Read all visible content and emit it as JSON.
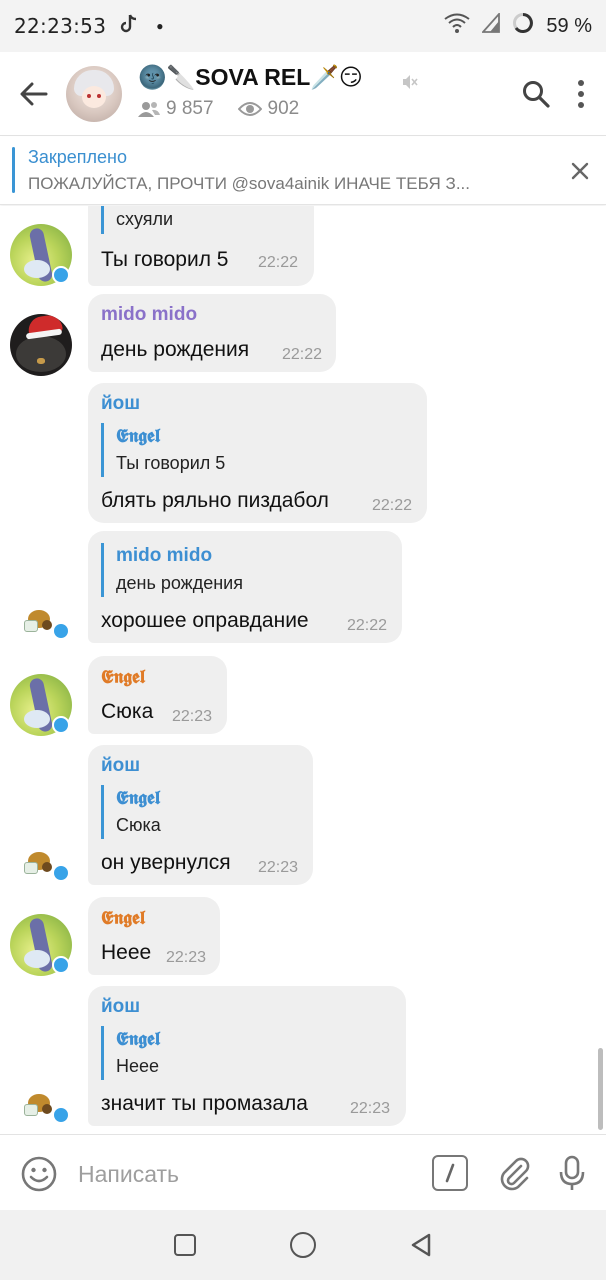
{
  "status_bar": {
    "time": "22:23:53",
    "battery": "59 %",
    "icons": [
      "tiktok-icon",
      "dot-icon",
      "wifi-icon",
      "signal-icon",
      "battery-ring-icon"
    ]
  },
  "header": {
    "title_prefix_emoji": "🌚🔪",
    "title_text": "SOVA REL",
    "title_suffix_emoji": "🗡️😏",
    "subscribers": "9 857",
    "viewers": "902"
  },
  "pinned": {
    "label": "Закреплено",
    "text": "ПОЖАЛУЙСТА, ПРОЧТИ @sova4ainik ИНАЧЕ ТЕБЯ З..."
  },
  "messages": [
    {
      "reply_text": "схуяли",
      "text": "Ты говорил 5",
      "time": "22:22"
    },
    {
      "sender": "mido mido",
      "text": "день рождения",
      "time": "22:22"
    },
    {
      "sender": "йош",
      "reply_name": "𝕰𝖓𝖌𝖊𝖑",
      "reply_text": "Ты говорил 5",
      "text": "блять ряльно пиздабол",
      "time": "22:22"
    },
    {
      "reply_name": "mido mido",
      "reply_text": "день рождения",
      "text": "хорошее оправдание",
      "time": "22:22"
    },
    {
      "sender": "𝕰𝖓𝖌𝖊𝖑",
      "text": "Сюка",
      "time": "22:23"
    },
    {
      "sender": "йош",
      "reply_name": "𝕰𝖓𝖌𝖊𝖑",
      "reply_text": "Сюка",
      "text": "он увернулся",
      "time": "22:23"
    },
    {
      "sender": "𝕰𝖓𝖌𝖊𝖑",
      "text": "Неее",
      "time": "22:23"
    },
    {
      "sender": "йош",
      "reply_name": "𝕰𝖓𝖌𝖊𝖑",
      "reply_text": "Неее",
      "text": "значит ты промазала",
      "time": "22:23"
    }
  ],
  "composer": {
    "placeholder": "Написать"
  },
  "colors": {
    "accent": "#3a95d5",
    "bubble": "#efefef",
    "sender_blue": "#3d8fd2",
    "sender_purple": "#8a71c9",
    "sender_orange": "#e07b27",
    "online": "#38a3e8"
  }
}
